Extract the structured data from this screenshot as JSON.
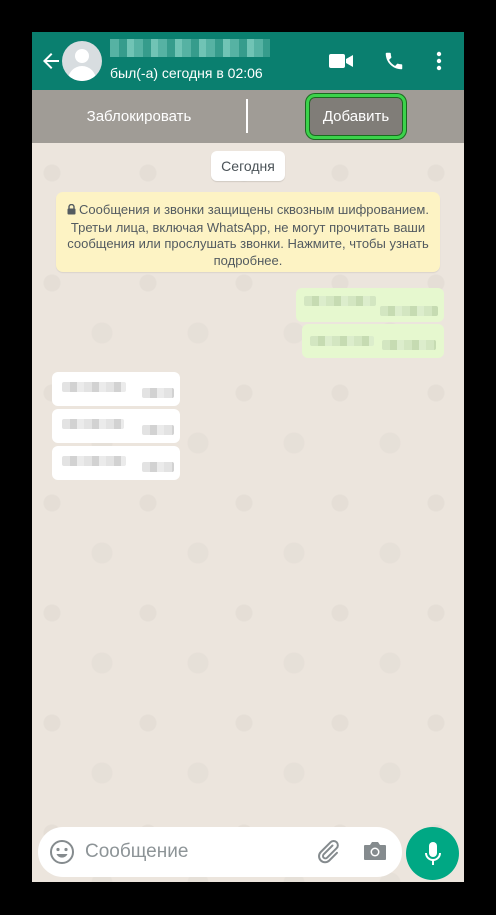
{
  "header": {
    "last_seen": "был(-а) сегодня в 02:06",
    "icons": [
      "back-arrow-icon",
      "video-call-icon",
      "phone-call-icon",
      "more-vert-icon"
    ],
    "color": "#0a7f6f"
  },
  "action_bar": {
    "block_label": "Заблокировать",
    "add_label": "Добавить",
    "highlight_color": "#3bd34b"
  },
  "chat": {
    "date_chip": "Сегодня",
    "encryption_notice": "Сообщения и звонки защищены сквозным шифрованием. Третьи лица, включая WhatsApp, не могут прочитать ваши сообщения или прослушать звонки. Нажмите, чтобы узнать подробнее."
  },
  "composer": {
    "placeholder": "Сообщение",
    "icons": [
      "emoji-icon",
      "attach-icon",
      "camera-icon",
      "mic-icon"
    ],
    "accent_color": "#00a884"
  }
}
